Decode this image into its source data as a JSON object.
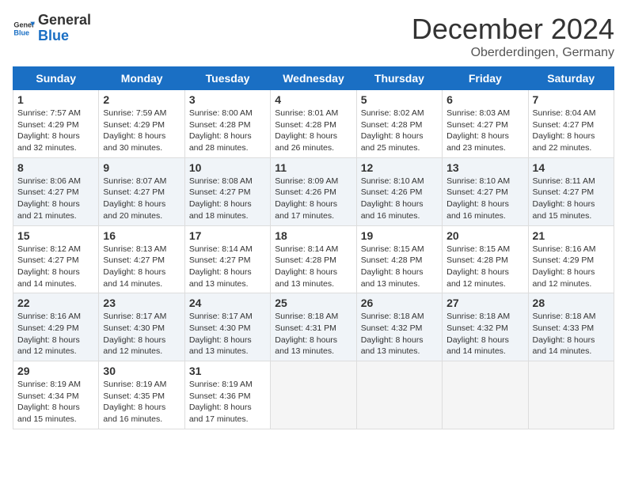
{
  "logo": {
    "text_general": "General",
    "text_blue": "Blue"
  },
  "header": {
    "month_year": "December 2024",
    "location": "Oberderdingen, Germany"
  },
  "weekdays": [
    "Sunday",
    "Monday",
    "Tuesday",
    "Wednesday",
    "Thursday",
    "Friday",
    "Saturday"
  ],
  "weeks": [
    [
      {
        "day": "1",
        "sunrise": "7:57 AM",
        "sunset": "4:29 PM",
        "daylight": "8 hours and 32 minutes."
      },
      {
        "day": "2",
        "sunrise": "7:59 AM",
        "sunset": "4:29 PM",
        "daylight": "8 hours and 30 minutes."
      },
      {
        "day": "3",
        "sunrise": "8:00 AM",
        "sunset": "4:28 PM",
        "daylight": "8 hours and 28 minutes."
      },
      {
        "day": "4",
        "sunrise": "8:01 AM",
        "sunset": "4:28 PM",
        "daylight": "8 hours and 26 minutes."
      },
      {
        "day": "5",
        "sunrise": "8:02 AM",
        "sunset": "4:28 PM",
        "daylight": "8 hours and 25 minutes."
      },
      {
        "day": "6",
        "sunrise": "8:03 AM",
        "sunset": "4:27 PM",
        "daylight": "8 hours and 23 minutes."
      },
      {
        "day": "7",
        "sunrise": "8:04 AM",
        "sunset": "4:27 PM",
        "daylight": "8 hours and 22 minutes."
      }
    ],
    [
      {
        "day": "8",
        "sunrise": "8:06 AM",
        "sunset": "4:27 PM",
        "daylight": "8 hours and 21 minutes."
      },
      {
        "day": "9",
        "sunrise": "8:07 AM",
        "sunset": "4:27 PM",
        "daylight": "8 hours and 20 minutes."
      },
      {
        "day": "10",
        "sunrise": "8:08 AM",
        "sunset": "4:27 PM",
        "daylight": "8 hours and 18 minutes."
      },
      {
        "day": "11",
        "sunrise": "8:09 AM",
        "sunset": "4:26 PM",
        "daylight": "8 hours and 17 minutes."
      },
      {
        "day": "12",
        "sunrise": "8:10 AM",
        "sunset": "4:26 PM",
        "daylight": "8 hours and 16 minutes."
      },
      {
        "day": "13",
        "sunrise": "8:10 AM",
        "sunset": "4:27 PM",
        "daylight": "8 hours and 16 minutes."
      },
      {
        "day": "14",
        "sunrise": "8:11 AM",
        "sunset": "4:27 PM",
        "daylight": "8 hours and 15 minutes."
      }
    ],
    [
      {
        "day": "15",
        "sunrise": "8:12 AM",
        "sunset": "4:27 PM",
        "daylight": "8 hours and 14 minutes."
      },
      {
        "day": "16",
        "sunrise": "8:13 AM",
        "sunset": "4:27 PM",
        "daylight": "8 hours and 14 minutes."
      },
      {
        "day": "17",
        "sunrise": "8:14 AM",
        "sunset": "4:27 PM",
        "daylight": "8 hours and 13 minutes."
      },
      {
        "day": "18",
        "sunrise": "8:14 AM",
        "sunset": "4:28 PM",
        "daylight": "8 hours and 13 minutes."
      },
      {
        "day": "19",
        "sunrise": "8:15 AM",
        "sunset": "4:28 PM",
        "daylight": "8 hours and 13 minutes."
      },
      {
        "day": "20",
        "sunrise": "8:15 AM",
        "sunset": "4:28 PM",
        "daylight": "8 hours and 12 minutes."
      },
      {
        "day": "21",
        "sunrise": "8:16 AM",
        "sunset": "4:29 PM",
        "daylight": "8 hours and 12 minutes."
      }
    ],
    [
      {
        "day": "22",
        "sunrise": "8:16 AM",
        "sunset": "4:29 PM",
        "daylight": "8 hours and 12 minutes."
      },
      {
        "day": "23",
        "sunrise": "8:17 AM",
        "sunset": "4:30 PM",
        "daylight": "8 hours and 12 minutes."
      },
      {
        "day": "24",
        "sunrise": "8:17 AM",
        "sunset": "4:30 PM",
        "daylight": "8 hours and 13 minutes."
      },
      {
        "day": "25",
        "sunrise": "8:18 AM",
        "sunset": "4:31 PM",
        "daylight": "8 hours and 13 minutes."
      },
      {
        "day": "26",
        "sunrise": "8:18 AM",
        "sunset": "4:32 PM",
        "daylight": "8 hours and 13 minutes."
      },
      {
        "day": "27",
        "sunrise": "8:18 AM",
        "sunset": "4:32 PM",
        "daylight": "8 hours and 14 minutes."
      },
      {
        "day": "28",
        "sunrise": "8:18 AM",
        "sunset": "4:33 PM",
        "daylight": "8 hours and 14 minutes."
      }
    ],
    [
      {
        "day": "29",
        "sunrise": "8:19 AM",
        "sunset": "4:34 PM",
        "daylight": "8 hours and 15 minutes."
      },
      {
        "day": "30",
        "sunrise": "8:19 AM",
        "sunset": "4:35 PM",
        "daylight": "8 hours and 16 minutes."
      },
      {
        "day": "31",
        "sunrise": "8:19 AM",
        "sunset": "4:36 PM",
        "daylight": "8 hours and 17 minutes."
      },
      null,
      null,
      null,
      null
    ]
  ],
  "labels": {
    "sunrise": "Sunrise:",
    "sunset": "Sunset:",
    "daylight": "Daylight:"
  }
}
